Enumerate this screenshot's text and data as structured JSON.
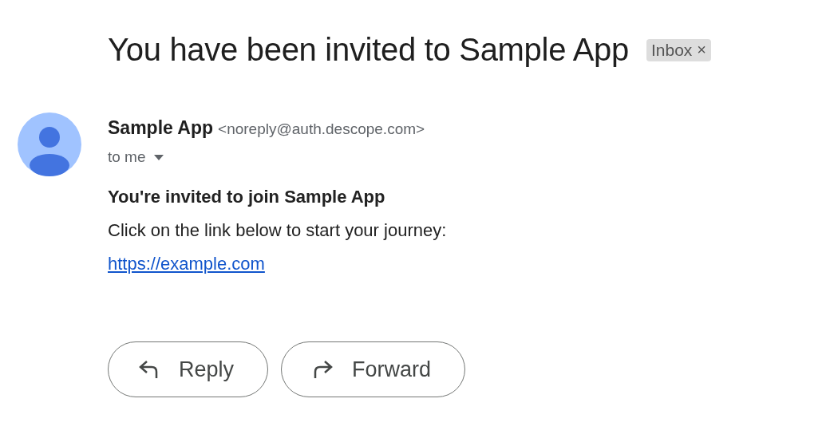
{
  "subject": "You have been invited to Sample App",
  "label": {
    "text": "Inbox",
    "close": "×"
  },
  "sender": {
    "name": "Sample App",
    "address": "<noreply@auth.descope.com>",
    "recipient": "to me"
  },
  "body": {
    "heading": "You're invited to join Sample App",
    "text": "Click on the link below to start your journey:",
    "link": "https://example.com"
  },
  "actions": [
    {
      "kind": "reply",
      "label": "Reply"
    },
    {
      "kind": "forward",
      "label": "Forward"
    }
  ]
}
